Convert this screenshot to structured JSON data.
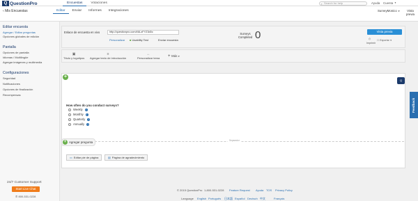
{
  "topbar": {
    "brand_letter": "Q",
    "brand_name": "QuestionPro",
    "tabs": [
      "Encuestas",
      "Votaciones"
    ],
    "search_placeholder": "Search for help",
    "help": "Ayuda",
    "account": "Cuenta"
  },
  "subbar": {
    "back": "Mis Encuestas",
    "tabs": [
      "Editar",
      "Enviar",
      "Informes",
      "Integraciones"
    ],
    "survey_name": "SurveyMonico",
    "preview_top_1": "Vista",
    "preview_top_2": "previa"
  },
  "sidebar": {
    "section1": "Editar encuesta",
    "items1": [
      "Agregar / Editar preguntas",
      "Opciones globales de edición"
    ],
    "section2": "Pantalla",
    "items2": [
      "Opciones de pantalla",
      "Idiomas / Multilingüe",
      "Agregar imágenes y multimedia"
    ],
    "section3": "Configuraciones",
    "items3": [
      "Seguridad",
      "Notificaciones",
      "Opciones de finalización",
      "Recompensas"
    ],
    "support": "24/7 Customer Support",
    "live_chat": "Start Live Chat",
    "phone": "800-531-0228"
  },
  "panel": {
    "link_label": "Enlace de encuesta en vivo",
    "url_value": "http://questionpro.com/t/ALzFYZ3d0c",
    "personalize": "Personalizar",
    "usability": "Usability Test",
    "send": "Enviar encuesta",
    "surveys_1": "Surveys",
    "surveys_2": "Completed",
    "count": "0",
    "preview_btn": "Vista previa",
    "imprimir": "Imprimir",
    "exportar": "Exportar"
  },
  "toolbar": {
    "items": [
      "Título y logotipos",
      "Agregar texto de introducción",
      "Personalizar tema",
      "Más"
    ]
  },
  "question": {
    "text": "How often do you conduct surveys?",
    "options": [
      "Weekly",
      "Monthly",
      "Quarterly",
      "Annually"
    ]
  },
  "canvas": {
    "separator": "Separador",
    "add_question": "Agregar pregunta",
    "footer_btn": "Editar pie de página",
    "thanks_btn": "Página de agradecimiento"
  },
  "side": {
    "feedback": "Feedback",
    "chat_badge": "Q"
  },
  "footer": {
    "copyright": "© 2015 QuestionPro",
    "phone": "1-800-531-0228",
    "links": [
      "Feature Request",
      "Ayuda",
      "TOS",
      "Privacy Policy"
    ],
    "language_label": "Language",
    "languages": [
      "English",
      "Português",
      "日本語",
      "Español",
      "Deutsch",
      "中文",
      "Français"
    ]
  },
  "colors": {
    "brand": "#1b3a6b",
    "accent": "#2a8fd6",
    "orange": "#f07c1a",
    "green": "#6ab04c"
  }
}
